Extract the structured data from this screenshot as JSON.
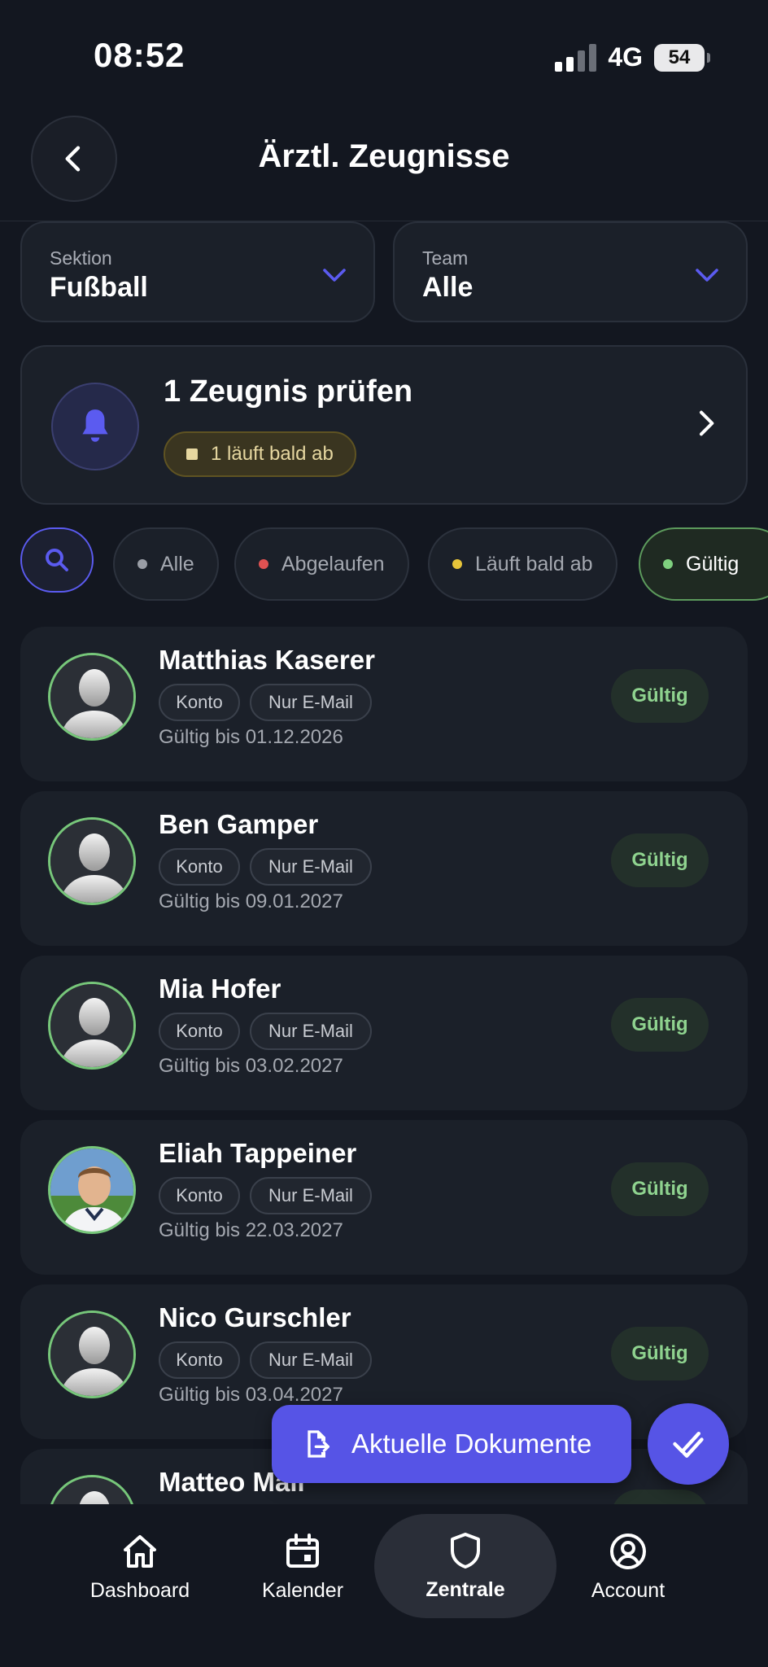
{
  "status_bar": {
    "time": "08:52",
    "network": "4G",
    "battery": "54"
  },
  "header": {
    "title": "Ärztl. Zeugnisse",
    "back_icon": "chevron-left-icon"
  },
  "filters": {
    "section": {
      "label": "Sektion",
      "value": "Fußball"
    },
    "team": {
      "label": "Team",
      "value": "Alle"
    }
  },
  "review": {
    "title": "1 Zeugnis prüfen",
    "badge": "1 läuft bald ab",
    "icon": "bell-icon"
  },
  "chips": [
    {
      "label": "Alle",
      "dot_color": "#9a9ea6"
    },
    {
      "label": "Abgelaufen",
      "dot_color": "#e05252"
    },
    {
      "label": "Läuft bald ab",
      "dot_color": "#e6c43a"
    },
    {
      "label": "Gültig",
      "dot_color": "#7fd07f"
    }
  ],
  "persons": [
    {
      "name": "Matthias Kaserer",
      "tag1": "Konto",
      "tag2": "Nur E-Mail",
      "valid": "Gültig bis 01.12.2026",
      "status": "Gültig",
      "photo": "silhouette"
    },
    {
      "name": "Ben Gamper",
      "tag1": "Konto",
      "tag2": "Nur E-Mail",
      "valid": "Gültig bis 09.01.2027",
      "status": "Gültig",
      "photo": "silhouette"
    },
    {
      "name": "Mia Hofer",
      "tag1": "Konto",
      "tag2": "Nur E-Mail",
      "valid": "Gültig bis 03.02.2027",
      "status": "Gültig",
      "photo": "silhouette"
    },
    {
      "name": "Eliah Tappeiner",
      "tag1": "Konto",
      "tag2": "Nur E-Mail",
      "valid": "Gültig bis 22.03.2027",
      "status": "Gültig",
      "photo": "photo"
    },
    {
      "name": "Nico Gurschler",
      "tag1": "Konto",
      "tag2": "Nur E-Mail",
      "valid": "Gültig bis 03.04.2027",
      "status": "Gültig",
      "photo": "silhouette"
    },
    {
      "name": "Matteo Mall",
      "tag1": "",
      "tag2": "",
      "valid": "",
      "status": "",
      "photo": "silhouette"
    }
  ],
  "actions": {
    "docs_label": "Aktuelle Dokumente"
  },
  "nav": [
    {
      "label": "Dashboard",
      "icon": "home-icon"
    },
    {
      "label": "Kalender",
      "icon": "calendar-icon"
    },
    {
      "label": "Zentrale",
      "icon": "shield-icon"
    },
    {
      "label": "Account",
      "icon": "account-icon"
    }
  ],
  "colors": {
    "accent": "#5654e6",
    "valid_green": "#8fd38f",
    "background": "#131720",
    "card": "#1b2029"
  }
}
